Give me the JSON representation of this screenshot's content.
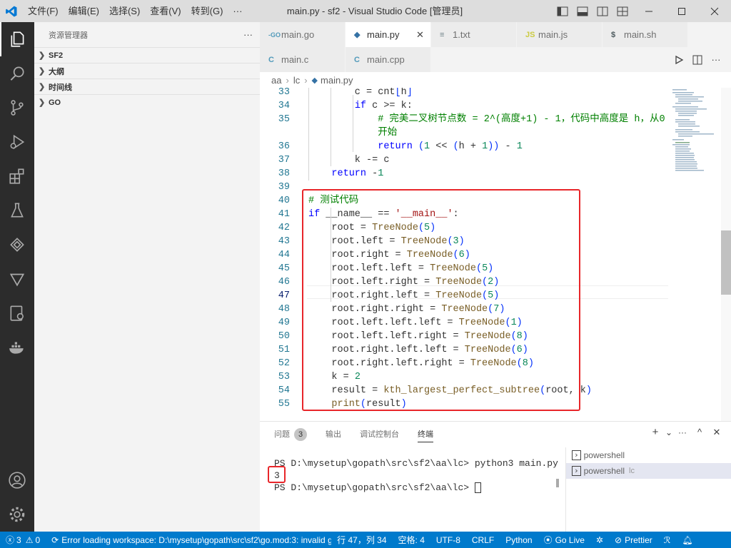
{
  "titlebar": {
    "menus": [
      "文件(F)",
      "编辑(E)",
      "选择(S)",
      "查看(V)",
      "转到(G)",
      "···"
    ],
    "title": "main.py - sf2 - Visual Studio Code [管理员]"
  },
  "sidebar": {
    "title": "资源管理器",
    "more": "···",
    "sections": [
      "SF2",
      "大纲",
      "时间线",
      "GO"
    ]
  },
  "tabs": {
    "row1": [
      {
        "icon": "-GO",
        "label": "main.go",
        "color": "#519aba"
      },
      {
        "icon": "◆",
        "label": "main.py",
        "color": "#3572a5",
        "close": "✕"
      },
      {
        "icon": "≡",
        "label": "1.txt",
        "color": "#6d8086"
      },
      {
        "icon": "JS",
        "label": "main.js",
        "color": "#cbcb41"
      },
      {
        "icon": "$",
        "label": "main.sh",
        "color": "#4d5a5e"
      }
    ],
    "row2": [
      {
        "icon": "C",
        "label": "main.c",
        "color": "#519aba"
      },
      {
        "icon": "C",
        "label": "main.cpp",
        "color": "#519aba"
      }
    ]
  },
  "breadcrumb": [
    "aa",
    "lc",
    "main.py"
  ],
  "editor": {
    "lines": [
      {
        "n": "33",
        "t": "        c = cnt[h]"
      },
      {
        "n": "34",
        "t": "        if c >= k:"
      },
      {
        "n": "35",
        "t": "            # 完美二叉树节点数 = 2^(高度+1) - 1，代码中高度是 h，从0"
      },
      {
        "n": "",
        "t": "            开始"
      },
      {
        "n": "36",
        "t": "            return (1 << (h + 1)) - 1"
      },
      {
        "n": "37",
        "t": "        k -= c"
      },
      {
        "n": "38",
        "t": "    return -1"
      },
      {
        "n": "39",
        "t": ""
      },
      {
        "n": "40",
        "t": "# 测试代码"
      },
      {
        "n": "41",
        "t": "if __name__ == '__main__':"
      },
      {
        "n": "42",
        "t": "    root = TreeNode(5)"
      },
      {
        "n": "43",
        "t": "    root.left = TreeNode(3)"
      },
      {
        "n": "44",
        "t": "    root.right = TreeNode(6)"
      },
      {
        "n": "45",
        "t": "    root.left.left = TreeNode(5)"
      },
      {
        "n": "46",
        "t": "    root.left.right = TreeNode(2)"
      },
      {
        "n": "47",
        "t": "    root.right.left = TreeNode(5)"
      },
      {
        "n": "48",
        "t": "    root.right.right = TreeNode(7)"
      },
      {
        "n": "49",
        "t": "    root.left.left.left = TreeNode(1)"
      },
      {
        "n": "50",
        "t": "    root.left.left.right = TreeNode(8)"
      },
      {
        "n": "51",
        "t": "    root.right.left.left = TreeNode(6)"
      },
      {
        "n": "52",
        "t": "    root.right.left.right = TreeNode(8)"
      },
      {
        "n": "53",
        "t": "    k = 2"
      },
      {
        "n": "54",
        "t": "    result = kth_largest_perfect_subtree(root, k)"
      },
      {
        "n": "55",
        "t": "    print(result)"
      }
    ]
  },
  "panel": {
    "tabs": [
      "问题",
      "输出",
      "调试控制台",
      "终端"
    ],
    "problems_count": "3",
    "actions": [
      "+",
      "⌄",
      "···",
      "^",
      "✕"
    ],
    "terminal_lines": [
      "PS D:\\mysetup\\gopath\\src\\sf2\\aa\\lc> python3 main.py",
      "3",
      "PS D:\\mysetup\\gopath\\src\\sf2\\aa\\lc> "
    ],
    "terminals": [
      {
        "name": "powershell",
        "sub": ""
      },
      {
        "name": "powershell",
        "sub": "lc"
      }
    ]
  },
  "statusbar": {
    "errors": "3",
    "warnings": "0",
    "message": "Error loading workspace: D:\\mysetup\\gopath\\src\\sf2\\go.mod:3: invalid g",
    "position": "行 47，列 34",
    "spaces": "空格: 4",
    "encoding": "UTF-8",
    "eol": "CRLF",
    "language": "Python",
    "golive": "Go Live",
    "prettier": "Prettier"
  },
  "colors": {
    "accent": "#007acc",
    "highlight": "#e8262a",
    "activitybar": "#2c2c2c"
  }
}
